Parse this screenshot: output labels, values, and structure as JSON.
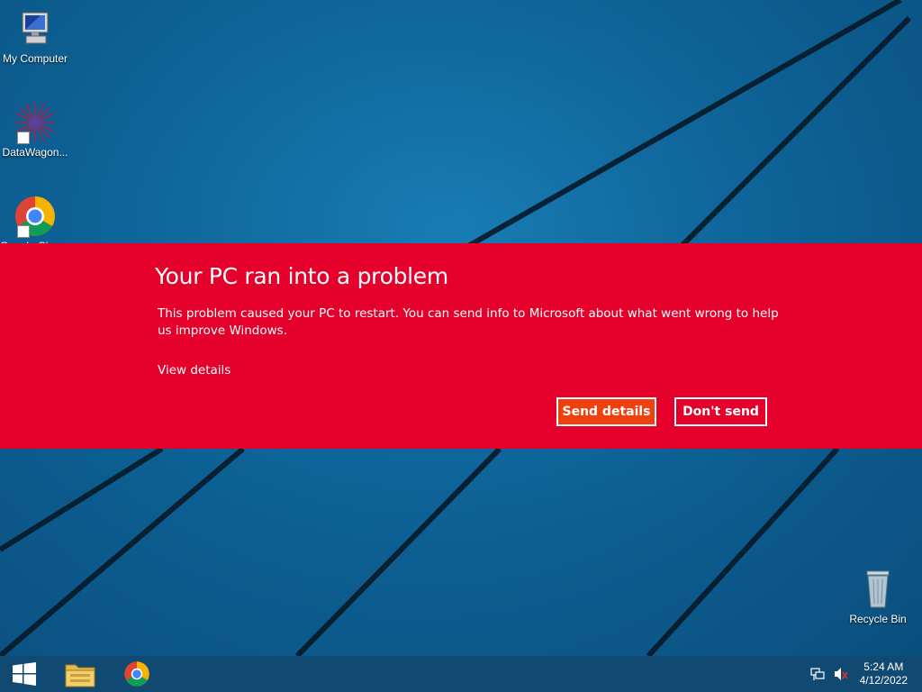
{
  "desktop": {
    "icons": [
      {
        "label": "My Computer",
        "icon": "computer-icon"
      },
      {
        "label": "DataWagon...",
        "icon": "datawagon-icon"
      },
      {
        "label": "Google Chrome",
        "icon": "chrome-icon"
      },
      {
        "label": "Recycle Bin",
        "icon": "recycle-bin-icon"
      }
    ]
  },
  "error_dialog": {
    "title": "Your PC ran into a problem",
    "message": "This problem caused your PC to restart. You can send info to Microsoft about what went wrong to help us improve Windows.",
    "view_details": "View details",
    "send_label": "Send details",
    "dont_send_label": "Don't send",
    "colors": {
      "banner": "#e4002b",
      "primary_button": "#f0400d"
    }
  },
  "taskbar": {
    "start_icon": "windows-logo-icon",
    "apps": [
      {
        "name": "File Explorer",
        "icon": "folder-icon"
      },
      {
        "name": "Google Chrome",
        "icon": "chrome-icon"
      }
    ],
    "tray": {
      "network_icon": "network-icon",
      "volume_icon": "volume-muted-icon",
      "time": "5:24 AM",
      "date": "4/12/2022"
    }
  }
}
